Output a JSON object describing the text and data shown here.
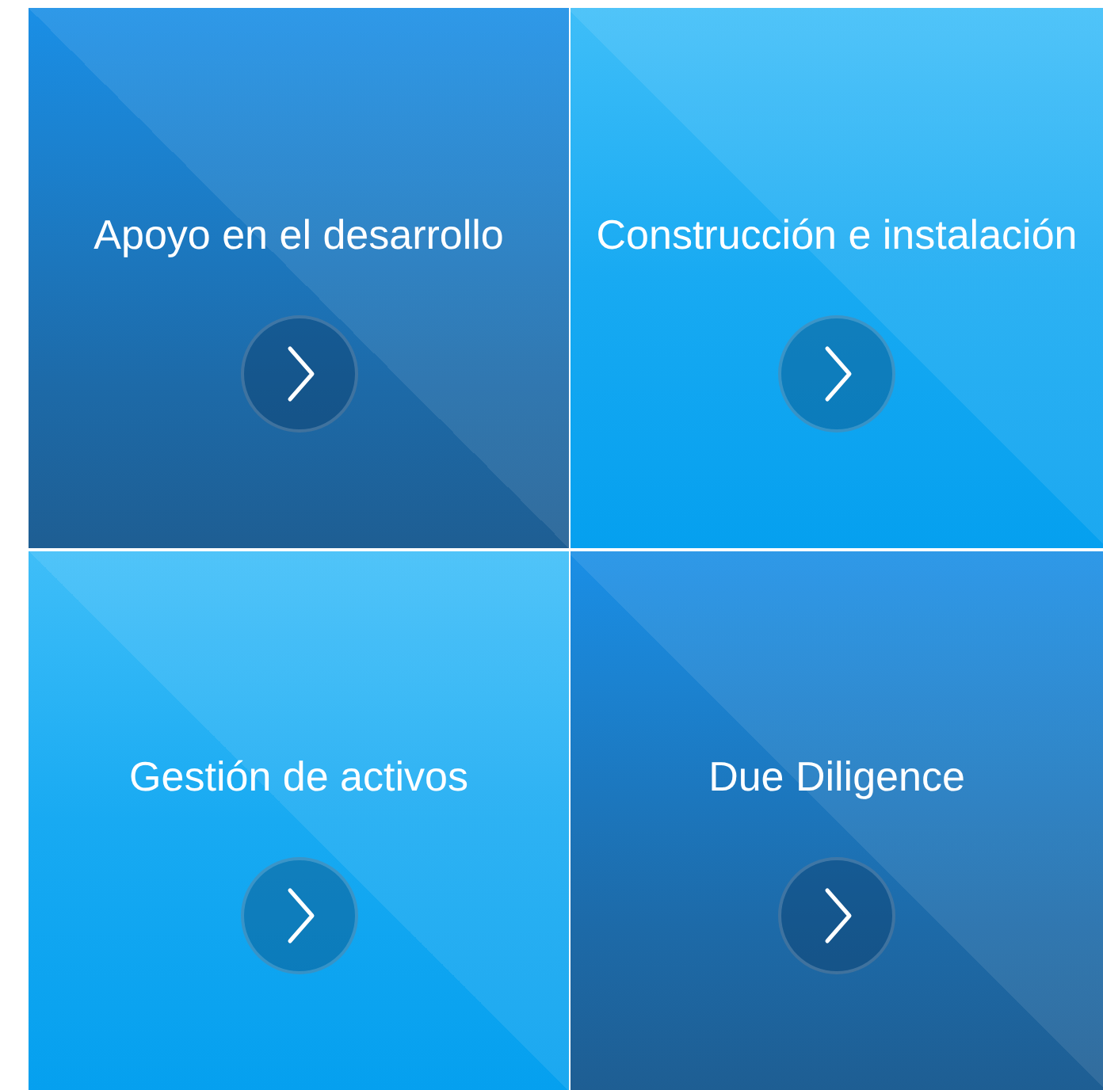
{
  "tiles": [
    {
      "title": "Apoyo en el desarrollo",
      "kind": "dark"
    },
    {
      "title": "Construcción e instalación",
      "kind": "light"
    },
    {
      "title": "Gestión de activos",
      "kind": "light"
    },
    {
      "title": "Due Diligence",
      "kind": "dark"
    }
  ]
}
